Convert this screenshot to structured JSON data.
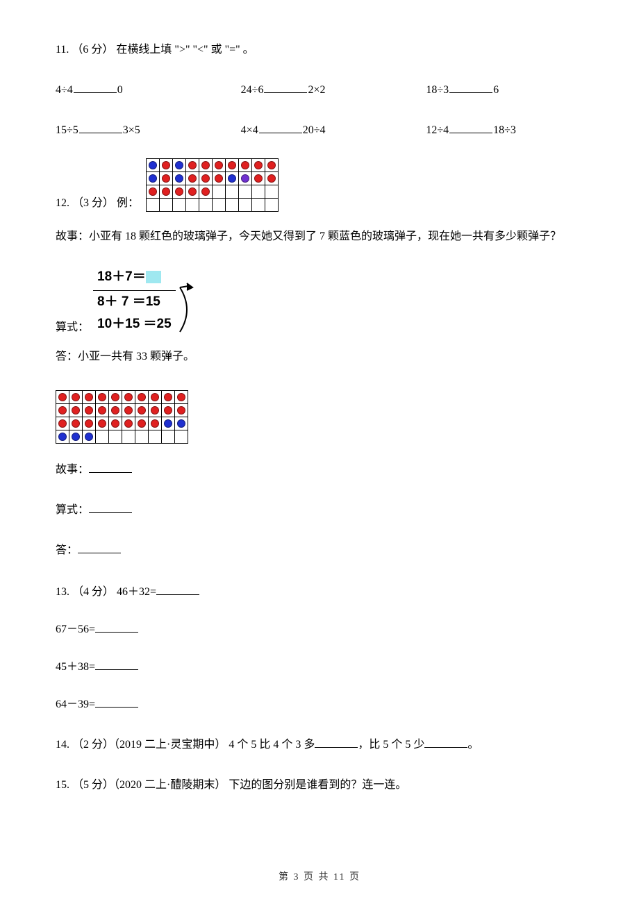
{
  "q11": {
    "header": "11.  （6 分）  在横线上填 \">\" \"<\" 或 \"=\" 。",
    "row1": {
      "a_left": "4÷4",
      "a_right": "0",
      "b_left": "24÷6",
      "b_right": "2×2",
      "c_left": "18÷3",
      "c_right": "6"
    },
    "row2": {
      "a_left": "15÷5",
      "a_right": "3×5",
      "b_left": "4×4",
      "b_right": "20÷4",
      "c_left": "12÷4",
      "c_right": "18÷3"
    }
  },
  "q12": {
    "header_prefix": "12.  （3 分）  例：",
    "story_label": "故事：",
    "story_example": "小亚有 18 颗红色的玻璃弹子，今天她又得到了 7 颗蓝色的玻璃弹子，现在她一共有多少颗弹子？",
    "formula_label": "算式：",
    "formula_top": "18＋7＝",
    "formula_mid": "8＋ 7 ＝15",
    "formula_bot": "10＋15 ＝25",
    "answer_example": "答：小亚一共有 33 颗弹子。",
    "story_prompt": "故事：",
    "formula_prompt": "算式：",
    "answer_prompt": "答："
  },
  "q13": {
    "header_prefix": "13.   （4 分）  46＋32=",
    "line2": "67－56=",
    "line3": "45＋38=",
    "line4": "64－39="
  },
  "q14": {
    "text_a": "14.   （2 分）（2019 二上·灵宝期中）  4 个 5 比 4 个 3 多",
    "text_b": "，比 5 个 5 少",
    "text_c": "。"
  },
  "q15": {
    "text": "15.   （5 分）（2020 二上·醴陵期末）  下边的图分别是谁看到的？连一连。"
  },
  "footer": {
    "text": "第  3  页  共  11  页"
  }
}
